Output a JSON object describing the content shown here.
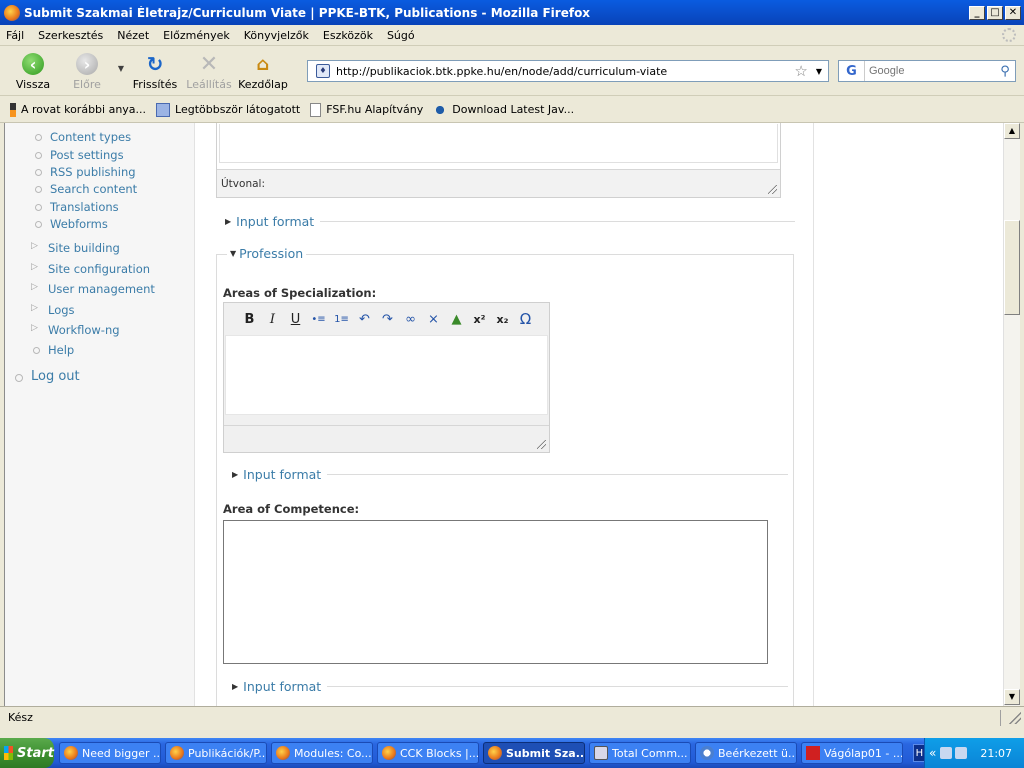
{
  "window": {
    "title": "Submit Szakmai Életrajz/Curriculum Viate | PPKE-BTK, Publications - Mozilla Firefox"
  },
  "menubar": [
    "Fájl",
    "Szerkesztés",
    "Nézet",
    "Előzmények",
    "Könyvjelzők",
    "Eszközök",
    "Súgó"
  ],
  "toolbar": {
    "back": "Vissza",
    "forward": "Előre",
    "reload": "Frissítés",
    "stop": "Leállítás",
    "home": "Kezdőlap",
    "url": "http://publikaciok.btk.ppke.hu/en/node/add/curriculum-viate",
    "search_placeholder": "Google"
  },
  "bookmarks": [
    "A rovat korábbi anya...",
    "Legtöbbször látogatott",
    "FSF.hu Alapítvány",
    "Download Latest Jav..."
  ],
  "sidebar": {
    "sub_items": [
      "Content types",
      "Post settings",
      "RSS publishing",
      "Search content",
      "Translations",
      "Webforms"
    ],
    "top_items": [
      {
        "label": "Site building",
        "style": "collapsed"
      },
      {
        "label": "Site configuration",
        "style": "collapsed"
      },
      {
        "label": "User management",
        "style": "collapsed"
      },
      {
        "label": "Logs",
        "style": "collapsed"
      },
      {
        "label": "Workflow-ng",
        "style": "collapsed"
      },
      {
        "label": "Help",
        "style": "leaf"
      }
    ],
    "logout": "Log out"
  },
  "form": {
    "path_label": "Útvonal:",
    "input_format": "Input format",
    "profession_legend": "Profession",
    "areas_label": "Areas of Specialization:",
    "competence_label": "Area of Competence:",
    "rte_buttons": [
      "B",
      "I",
      "U",
      "•≡",
      "1≡",
      "↶",
      "↷",
      "∞",
      "⨯",
      "▲",
      "x²",
      "x₂",
      "Ω"
    ]
  },
  "status": "Kész",
  "taskbar": {
    "start": "Start",
    "tasks": [
      {
        "label": "Need bigger ...",
        "icon": "firefox"
      },
      {
        "label": "Publikációk/P...",
        "icon": "firefox"
      },
      {
        "label": "Modules: Co...",
        "icon": "firefox"
      },
      {
        "label": "CCK Blocks |...",
        "icon": "firefox"
      },
      {
        "label": "Submit Sza...",
        "icon": "firefox",
        "active": true
      },
      {
        "label": "Total Comm...",
        "icon": "tc"
      },
      {
        "label": "Beérkezett ü...",
        "icon": "mail"
      },
      {
        "label": "Vágólap01 - ...",
        "icon": "paint"
      }
    ],
    "language": "HU",
    "clock": "21:07"
  }
}
